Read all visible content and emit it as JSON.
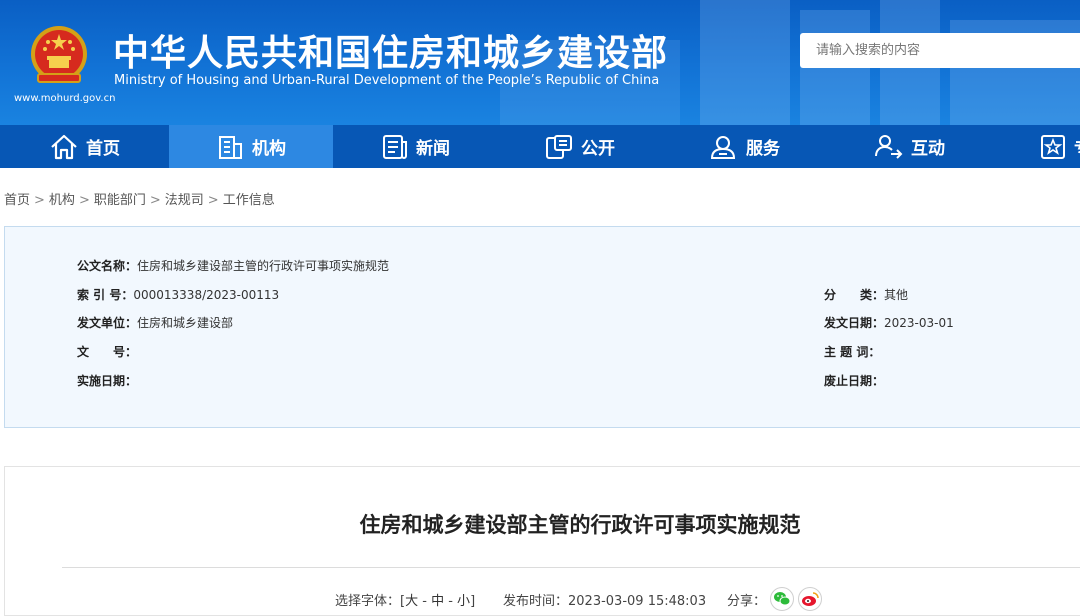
{
  "header": {
    "title": "中华人民共和国住房和城乡建设部",
    "subtitle": "Ministry of Housing and Urban-Rural Development of the People’s Republic of China",
    "domain": "www.mohurd.gov.cn",
    "search_placeholder": "请输入搜索的内容",
    "emblem_icon": "national-emblem-icon"
  },
  "nav": {
    "items": [
      {
        "label": "首页",
        "icon": "home-icon",
        "active": false
      },
      {
        "label": "机构",
        "icon": "building-icon",
        "active": true
      },
      {
        "label": "新闻",
        "icon": "news-icon",
        "active": false
      },
      {
        "label": "公开",
        "icon": "open-government-icon",
        "active": false
      },
      {
        "label": "服务",
        "icon": "service-user-icon",
        "active": false
      },
      {
        "label": "互动",
        "icon": "interaction-icon",
        "active": false
      },
      {
        "label": "专",
        "icon": "star-box-icon",
        "active": false
      }
    ]
  },
  "breadcrumb": {
    "items": [
      "首页",
      "机构",
      "职能部门",
      "法规司",
      "工作信息"
    ],
    "separator": ">"
  },
  "info": {
    "doc_name_label": "公文名称：",
    "doc_name_value": "住房和城乡建设部主管的行政许可事项实施规范",
    "index_label": "索 引 号：",
    "index_value": "000013338/2023-00113",
    "category_label": "分　　类：",
    "category_value": "其他",
    "issuer_label": "发文单位：",
    "issuer_value": "住房和城乡建设部",
    "issue_date_label": "发文日期：",
    "issue_date_value": "2023-03-01",
    "doc_number_label": "文　　号：",
    "doc_number_value": "",
    "keywords_label": "主 题 词：",
    "keywords_value": "",
    "effective_label": "实施日期：",
    "effective_value": "",
    "repeal_label": "废止日期：",
    "repeal_value": ""
  },
  "article": {
    "title": "住房和城乡建设部主管的行政许可事项实施规范",
    "font_label": "选择字体：[",
    "font_large": "大",
    "font_medium": "中",
    "font_small": "小",
    "font_sep": " - ",
    "font_close": "]",
    "publish_label": "发布时间：",
    "publish_value": "2023-03-09 15:48:03",
    "share_label": "分享：",
    "share_icons": [
      "wechat-icon",
      "weibo-icon"
    ]
  },
  "colors": {
    "header_blue": "#0a5fc4",
    "nav_blue": "#0757b5",
    "nav_active": "#2d88e2",
    "panel_bg": "#f2f8fe",
    "wechat_green": "#2dbb3a",
    "weibo_red": "#e6162d"
  }
}
